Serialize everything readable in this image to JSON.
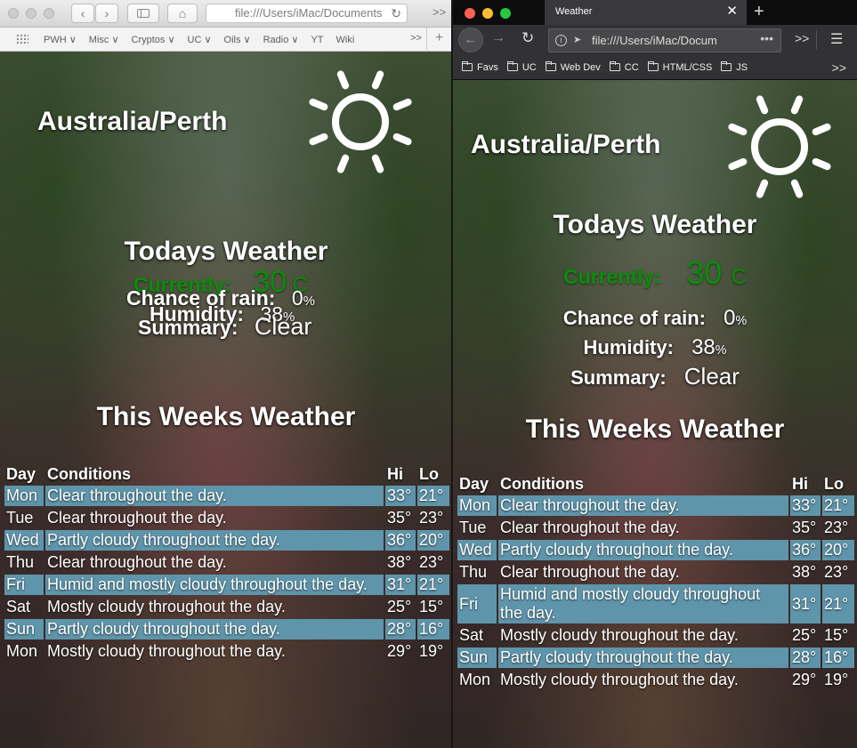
{
  "safari": {
    "address_bar": "file:///Users/iMac/Documents",
    "more_label": ">>",
    "bookmarks": [
      "PWH ∨",
      "Misc ∨",
      "Cryptos ∨",
      "UC ∨",
      "Oils ∨",
      "Radio ∨",
      "YT",
      "Wiki"
    ],
    "bookmarks_more": ">>",
    "new_tab": "+"
  },
  "firefox": {
    "tab_title": "Weather",
    "address_bar": "file:///Users/iMac/Docum",
    "bookmarks": [
      "Favs",
      "UC",
      "Web Dev",
      "CC",
      "HTML/CSS",
      "JS"
    ],
    "more_label": ">>",
    "overflow_dots": "•••"
  },
  "weather": {
    "location": "Australia/Perth",
    "today_heading": "Todays Weather",
    "currently_label": "Currently:",
    "current_temp": "30",
    "temp_unit": "C",
    "rain_label": "Chance of rain:",
    "rain_value": "0",
    "rain_unit": "%",
    "humidity_label": "Humidity:",
    "humidity_value": "38",
    "humidity_unit": "%",
    "summary_label": "Summary:",
    "summary_value": "Clear",
    "week_heading": "This Weeks Weather",
    "columns": {
      "day": "Day",
      "conditions": "Conditions",
      "hi": "Hi",
      "lo": "Lo"
    },
    "days": [
      {
        "day": "Mon",
        "conditions": "Clear throughout the day.",
        "hi": "33°",
        "lo": "21°"
      },
      {
        "day": "Tue",
        "conditions": "Clear throughout the day.",
        "hi": "35°",
        "lo": "23°"
      },
      {
        "day": "Wed",
        "conditions": "Partly cloudy throughout the day.",
        "hi": "36°",
        "lo": "20°"
      },
      {
        "day": "Thu",
        "conditions": "Clear throughout the day.",
        "hi": "38°",
        "lo": "23°"
      },
      {
        "day": "Fri",
        "conditions": "Humid and mostly cloudy throughout the day.",
        "hi": "31°",
        "lo": "21°"
      },
      {
        "day": "Sat",
        "conditions": "Mostly cloudy throughout the day.",
        "hi": "25°",
        "lo": "15°"
      },
      {
        "day": "Sun",
        "conditions": "Partly cloudy throughout the day.",
        "hi": "28°",
        "lo": "16°"
      },
      {
        "day": "Mon",
        "conditions": "Mostly cloudy throughout the day.",
        "hi": "29°",
        "lo": "19°"
      }
    ]
  },
  "icons": {
    "weather": "sun-icon"
  },
  "colors": {
    "row_highlight": "#5f95aa",
    "temperature": "#0a8e0a"
  }
}
